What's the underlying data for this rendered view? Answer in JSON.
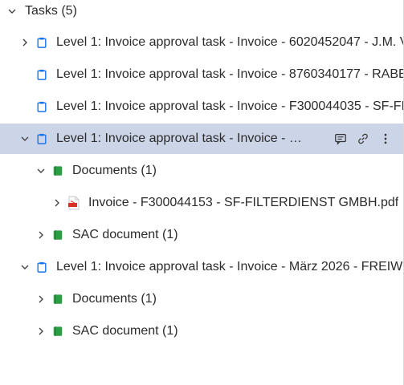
{
  "tree": {
    "root_label": "Tasks (5)",
    "tasks": [
      {
        "label": "Level 1: Invoice approval task - Invoice - 6020452047 - J.M. V"
      },
      {
        "label": "Level 1: Invoice approval task - Invoice - 8760340177 - RABE"
      },
      {
        "label": "Level 1: Invoice approval task - Invoice - F300044035 - SF-FI"
      },
      {
        "label": "Level 1: Invoice approval task - Invoice - F…",
        "documents_label": "Documents (1)",
        "file_label": "Invoice - F300044153 - SF-FILTERDIENST GMBH.pdf",
        "sac_label": "SAC document (1)"
      },
      {
        "label": "Level 1: Invoice approval task - Invoice - März 2026 - FREIWI",
        "documents_label": "Documents (1)",
        "sac_label": "SAC document (1)"
      }
    ]
  },
  "colors": {
    "task_icon": "#1a73e8",
    "doc_icon": "#2e9e44",
    "selected_bg": "#ccd5e8",
    "pdf_red": "#d93025"
  },
  "icons": [
    "chevron-down-icon",
    "chevron-right-icon",
    "clipboard-icon",
    "green-book-icon",
    "pdf-file-icon",
    "comment-icon",
    "link-icon",
    "more-vertical-icon"
  ]
}
